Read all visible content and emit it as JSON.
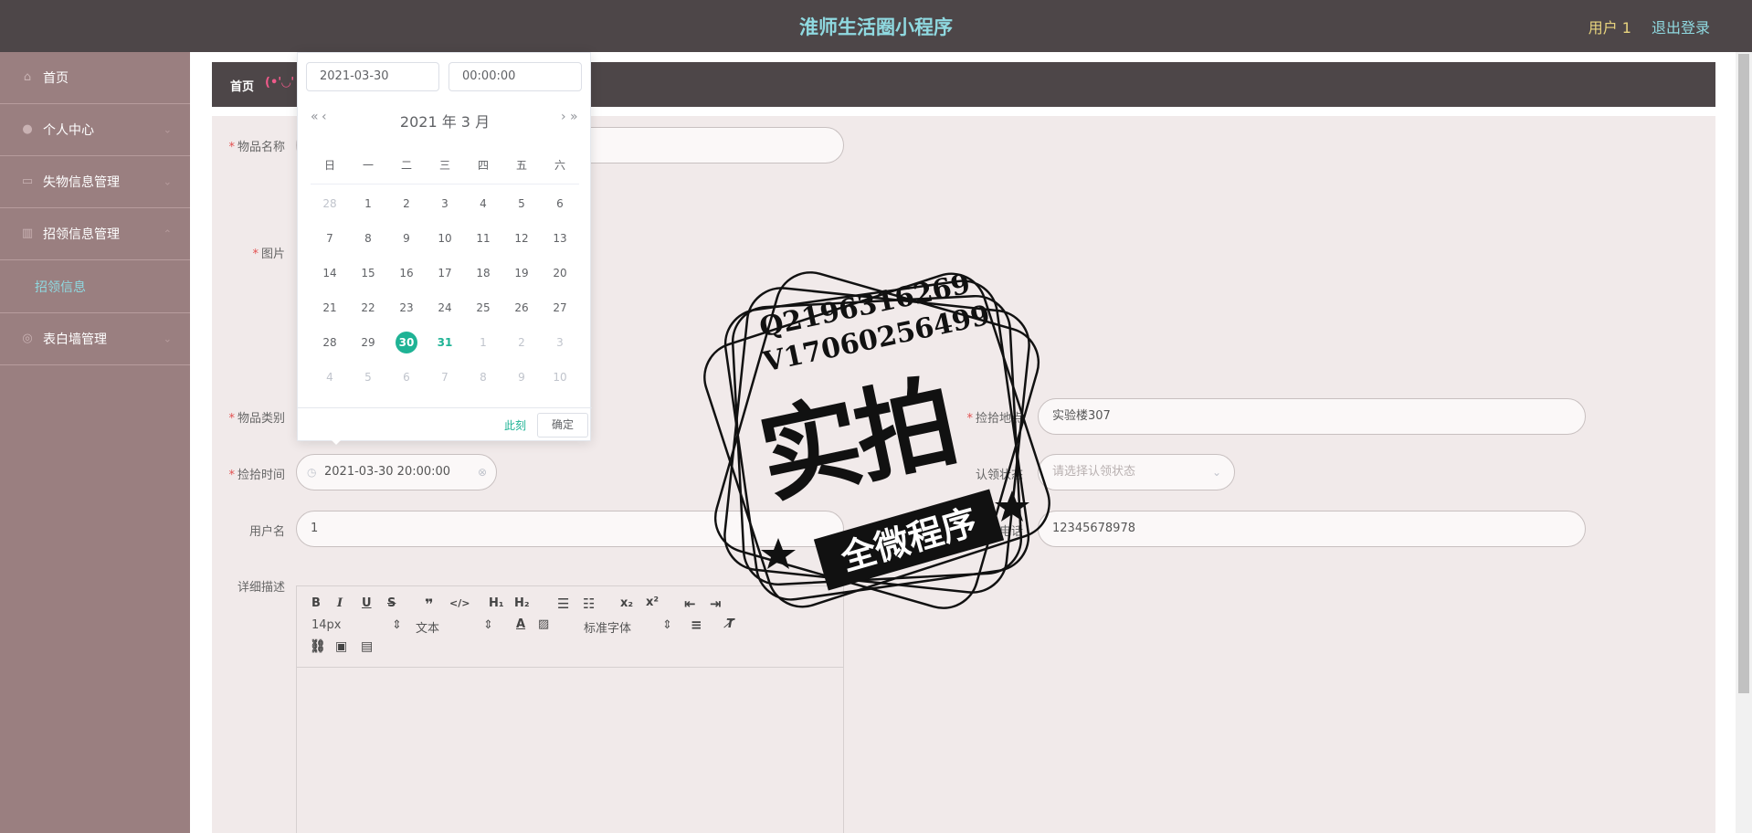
{
  "header": {
    "app_title": "淮师生活圈小程序",
    "user_label": "用户 1",
    "logout_label": "退出登录"
  },
  "sidebar": {
    "items": [
      {
        "label": "首页",
        "icon": "home-icon"
      },
      {
        "label": "个人中心",
        "icon": "user-icon"
      },
      {
        "label": "失物信息管理",
        "icon": "box-icon"
      },
      {
        "label": "招领信息管理",
        "icon": "building-icon"
      },
      {
        "label": "招领信息",
        "icon": ""
      },
      {
        "label": "表白墙管理",
        "icon": "heart-icon"
      }
    ]
  },
  "breadcrumb": {
    "home": "首页",
    "emoticon": "(•'◡'"
  },
  "form": {
    "item_name_label": "物品名称",
    "image_label": "图片",
    "category_label": "物品类别",
    "pickup_place_label": "捡拾地点",
    "pickup_place_value": "实验楼307",
    "pickup_time_label": "捡拾时间",
    "pickup_time_value": "2021-03-30 20:00:00",
    "claim_status_label": "认领状态",
    "claim_status_placeholder": "请选择认领状态",
    "username_label": "用户名",
    "username_value": "1",
    "phone_label": "联系电话",
    "phone_value": "12345678978",
    "description_label": "详细描述"
  },
  "editor": {
    "font_size": "14px",
    "paragraph": "文本",
    "font_family": "标准字体"
  },
  "datepicker": {
    "date_input": "2021-03-30",
    "time_input": "00:00:00",
    "header": "2021 年  3 月",
    "weekdays": [
      "日",
      "一",
      "二",
      "三",
      "四",
      "五",
      "六"
    ],
    "days": [
      {
        "d": "28",
        "t": "other"
      },
      {
        "d": "1",
        "t": ""
      },
      {
        "d": "2",
        "t": ""
      },
      {
        "d": "3",
        "t": ""
      },
      {
        "d": "4",
        "t": ""
      },
      {
        "d": "5",
        "t": ""
      },
      {
        "d": "6",
        "t": ""
      },
      {
        "d": "7",
        "t": ""
      },
      {
        "d": "8",
        "t": ""
      },
      {
        "d": "9",
        "t": ""
      },
      {
        "d": "10",
        "t": ""
      },
      {
        "d": "11",
        "t": ""
      },
      {
        "d": "12",
        "t": ""
      },
      {
        "d": "13",
        "t": ""
      },
      {
        "d": "14",
        "t": ""
      },
      {
        "d": "15",
        "t": ""
      },
      {
        "d": "16",
        "t": ""
      },
      {
        "d": "17",
        "t": ""
      },
      {
        "d": "18",
        "t": ""
      },
      {
        "d": "19",
        "t": ""
      },
      {
        "d": "20",
        "t": ""
      },
      {
        "d": "21",
        "t": ""
      },
      {
        "d": "22",
        "t": ""
      },
      {
        "d": "23",
        "t": ""
      },
      {
        "d": "24",
        "t": ""
      },
      {
        "d": "25",
        "t": ""
      },
      {
        "d": "26",
        "t": ""
      },
      {
        "d": "27",
        "t": ""
      },
      {
        "d": "28",
        "t": ""
      },
      {
        "d": "29",
        "t": ""
      },
      {
        "d": "30",
        "t": "selected"
      },
      {
        "d": "31",
        "t": "today"
      },
      {
        "d": "1",
        "t": "other"
      },
      {
        "d": "2",
        "t": "other"
      },
      {
        "d": "3",
        "t": "other"
      },
      {
        "d": "4",
        "t": "other"
      },
      {
        "d": "5",
        "t": "other"
      },
      {
        "d": "6",
        "t": "other"
      },
      {
        "d": "7",
        "t": "other"
      },
      {
        "d": "8",
        "t": "other"
      },
      {
        "d": "9",
        "t": "other"
      },
      {
        "d": "10",
        "t": "other"
      }
    ],
    "now_label": "此刻",
    "ok_label": "确定"
  },
  "watermark": {
    "line1": "Q2196316269",
    "line2": "V17060256499",
    "big_text": "实拍",
    "banner": "全微程序"
  },
  "colors": {
    "accent": "#1fb395",
    "header_bg": "#4d4648",
    "sidebar_bg": "#9a7f80",
    "title_color": "#8fd9e0"
  }
}
